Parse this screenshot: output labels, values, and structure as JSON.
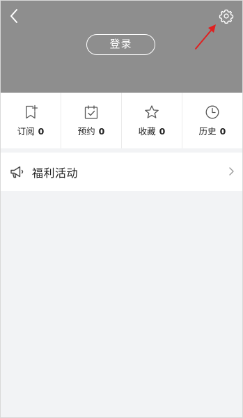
{
  "header": {
    "login_label": "登录",
    "background_color": "#8e8e8e",
    "annotation_color": "#e02020"
  },
  "stats": [
    {
      "label": "订阅",
      "count": "0",
      "icon": "bookmark-plus-icon"
    },
    {
      "label": "预约",
      "count": "0",
      "icon": "calendar-check-icon"
    },
    {
      "label": "收藏",
      "count": "0",
      "icon": "star-icon"
    },
    {
      "label": "历史",
      "count": "0",
      "icon": "clock-icon"
    }
  ],
  "menu": {
    "welfare_label": "福利活动",
    "welfare_icon": "megaphone-icon"
  }
}
